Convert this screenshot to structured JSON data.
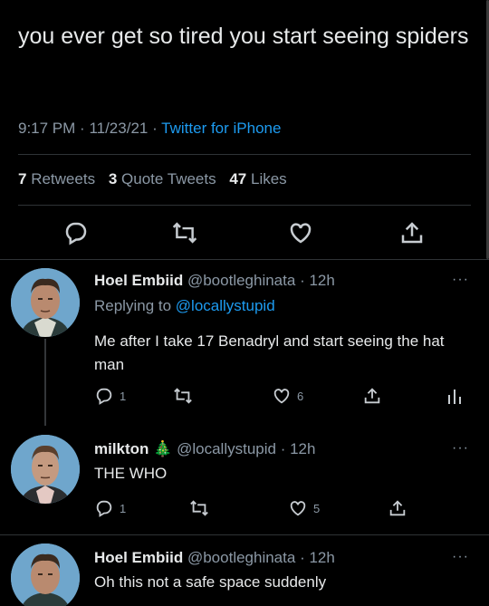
{
  "main_tweet": {
    "text": "you ever get so tired you start seeing spiders",
    "time": "9:17 PM",
    "date": "11/23/21",
    "source": "Twitter for iPhone",
    "retweets_count": "7",
    "retweets_label": "Retweets",
    "quote_count": "3",
    "quote_label": "Quote Tweets",
    "likes_count": "47",
    "likes_label": "Likes"
  },
  "replies": [
    {
      "name": "Hoel Embiid",
      "handle": "@bootleghinata",
      "time": "12h",
      "replying_prefix": "Replying to",
      "replying_to": "@locallystupid",
      "text": "Me after I take 17 Benadryl and start seeing the hat man",
      "reply_count": "1",
      "like_count": "6"
    },
    {
      "name": "milkton",
      "emoji": "🎄",
      "handle": "@locallystupid",
      "time": "12h",
      "text": "THE WHO",
      "reply_count": "1",
      "like_count": "5"
    },
    {
      "name": "Hoel Embiid",
      "handle": "@bootleghinata",
      "time": "12h",
      "text": "Oh this not a safe space suddenly"
    }
  ],
  "colors": {
    "accent": "#1d9bf0",
    "muted": "#8b98a5",
    "text": "#e7e9ea",
    "bg": "#000000"
  }
}
